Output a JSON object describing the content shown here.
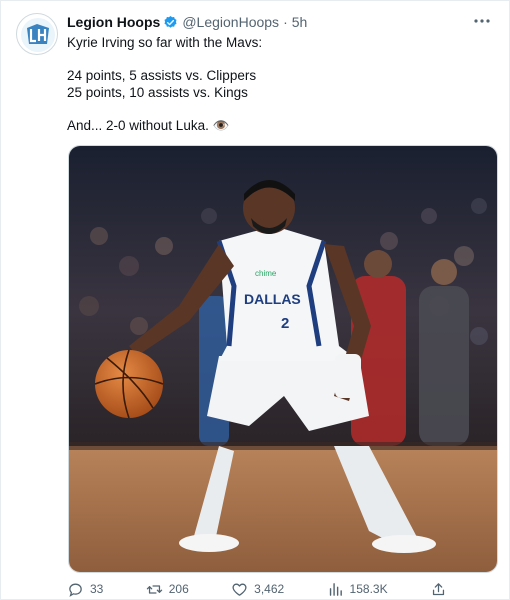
{
  "tweet": {
    "author": {
      "display_name": "Legion Hoops",
      "handle": "@LegionHoops",
      "verified": true,
      "logo_text": "LH",
      "badge_color": "#1d9bf0"
    },
    "separator": "·",
    "timestamp": "5h",
    "text_lines": [
      "Kyrie Irving so far with the Mavs:",
      "",
      "24 points, 5 assists vs. Clippers",
      "25 points, 10 assists vs. Kings",
      "",
      "And... 2-0 without Luka. 👁️"
    ],
    "media": {
      "icon": "basketball-player-photo",
      "jersey_text": "DALLAS",
      "jersey_number": "2",
      "sponsor": "chime"
    },
    "actions": {
      "replies": "33",
      "retweets": "206",
      "likes": "3,462",
      "views": "158.3K"
    },
    "icons": {
      "more": "more-icon",
      "reply": "reply-icon",
      "retweet": "retweet-icon",
      "like": "heart-icon",
      "views": "views-icon",
      "share": "share-icon"
    }
  }
}
